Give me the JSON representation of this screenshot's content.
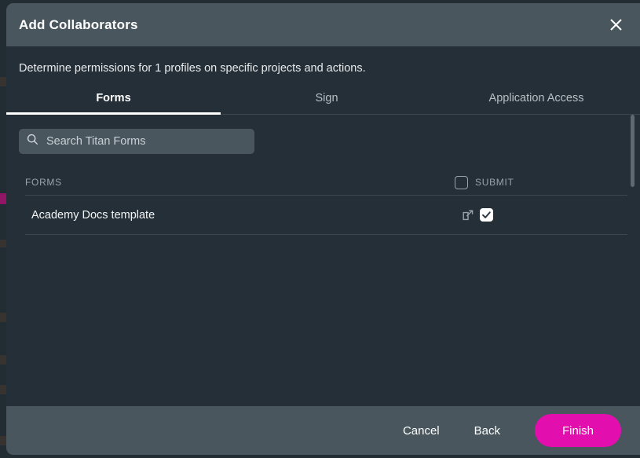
{
  "dialog": {
    "title": "Add  Collaborators",
    "subtitle": "Determine permissions for 1 profiles on specific projects and actions.",
    "close_icon": "close-icon"
  },
  "tabs": [
    {
      "label": "Forms",
      "active": true
    },
    {
      "label": "Sign",
      "active": false
    },
    {
      "label": "Application Access",
      "active": false
    }
  ],
  "search": {
    "placeholder": "Search Titan Forms",
    "value": "",
    "icon": "search-icon"
  },
  "table": {
    "columns": [
      {
        "key": "forms",
        "label": "FORMS"
      },
      {
        "key": "submit",
        "label": "SUBMIT",
        "checkbox": false
      }
    ],
    "rows": [
      {
        "name": "Academy Docs template",
        "open_icon": "external-link-icon",
        "submit_checked": true
      }
    ]
  },
  "footer": {
    "cancel_label": "Cancel",
    "back_label": "Back",
    "finish_label": "Finish"
  },
  "colors": {
    "accent": "#e20fae",
    "titlebar": "#49565e",
    "body": "#252f37",
    "muted_text": "#9aa3a9"
  }
}
